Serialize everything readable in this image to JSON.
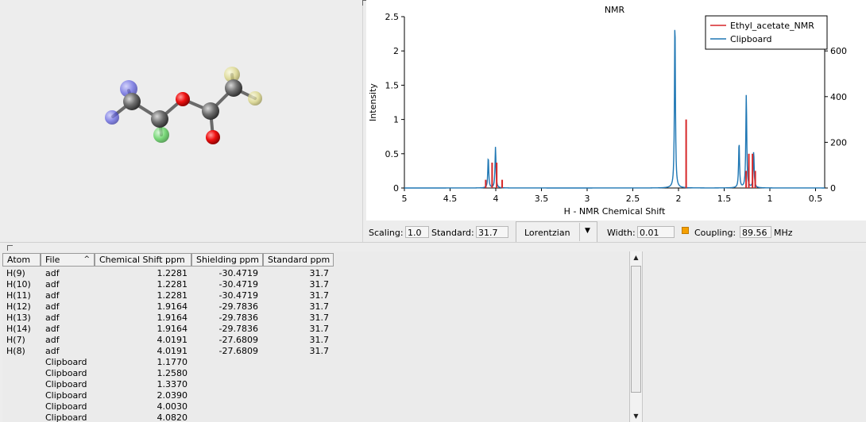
{
  "plot": {
    "title": "NMR",
    "xlabel": "H - NMR Chemical Shift",
    "ylabel": "Intensity",
    "x_ticks": [
      "5",
      "4.5",
      "4",
      "3.5",
      "3",
      "2.5",
      "2",
      "1.5",
      "1",
      "0.5"
    ],
    "y_ticks_left": [
      "0",
      "0.5",
      "1",
      "1.5",
      "2",
      "2.5"
    ],
    "y_ticks_right": [
      "0",
      "200",
      "400",
      "600"
    ],
    "legend": [
      "Ethyl_acetate_NMR",
      "Clipboard"
    ]
  },
  "chart_data": {
    "type": "line",
    "title": "NMR",
    "xlabel": "H - NMR Chemical Shift",
    "ylabel": "Intensity",
    "xlim": [
      5.0,
      0.4
    ],
    "ylim": [
      0,
      2.5
    ],
    "y2lim": [
      0,
      750
    ],
    "x_reversed": true,
    "grid": false,
    "legend_position": "top-right",
    "series": [
      {
        "name": "Ethyl_acetate_NMR",
        "color": "#d62728",
        "style": "sticks",
        "peaks": [
          {
            "x": 1.26,
            "y": 0.25
          },
          {
            "x": 1.23,
            "y": 0.5
          },
          {
            "x": 1.19,
            "y": 0.5
          },
          {
            "x": 1.16,
            "y": 0.25
          },
          {
            "x": 1.9164,
            "y": 1.0
          },
          {
            "x": 4.11,
            "y": 0.12
          },
          {
            "x": 4.04,
            "y": 0.37
          },
          {
            "x": 3.99,
            "y": 0.37
          },
          {
            "x": 3.93,
            "y": 0.12
          }
        ]
      },
      {
        "name": "Clipboard",
        "color": "#1f77b4",
        "style": "line",
        "axis": "right",
        "peaks": [
          {
            "x": 1.177,
            "y": 160
          },
          {
            "x": 1.258,
            "y": 410
          },
          {
            "x": 1.337,
            "y": 200
          },
          {
            "x": 2.039,
            "y": 745
          },
          {
            "x": 4.003,
            "y": 180
          },
          {
            "x": 4.082,
            "y": 135
          }
        ]
      }
    ]
  },
  "controls": {
    "scaling_label": "Scaling:",
    "scaling_value": "1.0",
    "standard_label": "Standard:",
    "standard_value": "31.7",
    "lineshape": "Lorentzian",
    "width_label": "Width:",
    "width_value": "0.01",
    "coupling_label": "Coupling:",
    "coupling_value": "89.56",
    "coupling_unit": "MHz",
    "coupling_color": "#f5a000"
  },
  "table": {
    "headers": [
      "Atom",
      "File",
      "Chemical Shift ppm",
      "Shielding ppm",
      "Standard ppm"
    ],
    "rows": [
      [
        "H(9)",
        "adf",
        "1.2281",
        "-30.4719",
        "31.7"
      ],
      [
        "H(10)",
        "adf",
        "1.2281",
        "-30.4719",
        "31.7"
      ],
      [
        "H(11)",
        "adf",
        "1.2281",
        "-30.4719",
        "31.7"
      ],
      [
        "H(12)",
        "adf",
        "1.9164",
        "-29.7836",
        "31.7"
      ],
      [
        "H(13)",
        "adf",
        "1.9164",
        "-29.7836",
        "31.7"
      ],
      [
        "H(14)",
        "adf",
        "1.9164",
        "-29.7836",
        "31.7"
      ],
      [
        "H(7)",
        "adf",
        "4.0191",
        "-27.6809",
        "31.7"
      ],
      [
        "H(8)",
        "adf",
        "4.0191",
        "-27.6809",
        "31.7"
      ],
      [
        "",
        "Clipboard",
        "1.1770",
        "",
        ""
      ],
      [
        "",
        "Clipboard",
        "1.2580",
        "",
        ""
      ],
      [
        "",
        "Clipboard",
        "1.3370",
        "",
        ""
      ],
      [
        "",
        "Clipboard",
        "2.0390",
        "",
        ""
      ],
      [
        "",
        "Clipboard",
        "4.0030",
        "",
        ""
      ],
      [
        "",
        "Clipboard",
        "4.0820",
        "",
        ""
      ]
    ]
  }
}
